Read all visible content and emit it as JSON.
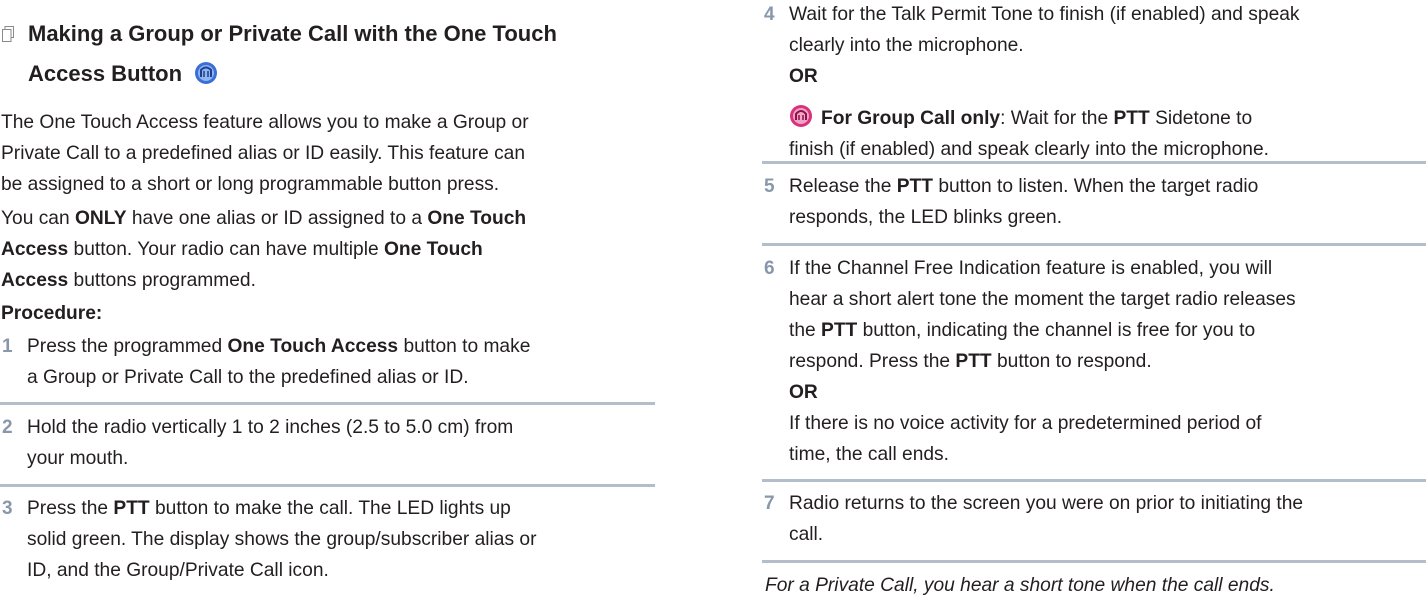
{
  "left": {
    "section_icon": "stacked-pages-icon",
    "title_line1": "Making a Group or Private Call with the One Touch",
    "title_line2": "Access Button",
    "title_button_icon": "one-touch-access-icon",
    "intro_line1": "The One Touch Access feature allows you to make a Group or",
    "intro_line2": "Private Call to a predefined alias or ID easily. This feature can",
    "intro_line3": "be assigned to a short or long programmable button press.",
    "p2_l1_a": "You can ",
    "p2_l1_b": "ONLY",
    "p2_l1_c": " have one alias or ID assigned to a ",
    "p2_l1_d": "One Touch",
    "p2_l2_a": "Access",
    "p2_l2_b": " button. Your radio can have multiple ",
    "p2_l2_c": "One Touch",
    "p2_l3_a": "Access",
    "p2_l3_b": " buttons programmed.",
    "procedure": "Procedure:",
    "s1_num": "1",
    "s1_l1_a": "Press the programmed ",
    "s1_l1_b": "One Touch Access",
    "s1_l1_c": " button to make",
    "s1_l2": "a Group or Private Call to the predefined alias or ID.",
    "s2_num": "2",
    "s2_l1": "Hold the radio vertically 1 to 2 inches (2.5 to 5.0 cm) from",
    "s2_l2": "your mouth.",
    "s3_num": "3",
    "s3_l1_a": "Press the ",
    "s3_l1_b": "PTT",
    "s3_l1_c": " button to make the call. The LED lights up",
    "s3_l2": "solid green. The display shows the group/subscriber alias or",
    "s3_l3": "ID, and the Group/Private Call icon."
  },
  "right": {
    "s4_num": "4",
    "s4_l1": "Wait for the Talk Permit Tone to finish (if enabled) and speak",
    "s4_l2": "clearly into the microphone.",
    "s4_or": "OR",
    "s4_icon": "ptt-sidetone-icon",
    "s4_l3_a": "For Group Call only",
    "s4_l3_b": ": Wait for the ",
    "s4_l3_c": "PTT",
    "s4_l3_d": " Sidetone to",
    "s4_l4": "finish (if enabled) and speak clearly into the microphone.",
    "s5_num": "5",
    "s5_l1_a": "Release the ",
    "s5_l1_b": "PTT",
    "s5_l1_c": " button to listen. When the target radio",
    "s5_l2": "responds, the LED blinks green.",
    "s6_num": "6",
    "s6_l1": "If the Channel Free Indication feature is enabled, you will",
    "s6_l2": "hear a short alert tone the moment the target radio releases",
    "s6_l3_a": "the ",
    "s6_l3_b": "PTT",
    "s6_l3_c": " button, indicating the channel is free for you to",
    "s6_l4_a": "respond. Press the ",
    "s6_l4_b": "PTT",
    "s6_l4_c": " button to respond.",
    "s6_or": "OR",
    "s6_l5": "If there is no voice activity for a predetermined period of",
    "s6_l6": "time, the call ends.",
    "s7_num": "7",
    "s7_l1": "Radio returns to the screen you were on prior to initiating the",
    "s7_l2": "call.",
    "note": "For a Private Call, you hear a short tone when the call ends."
  },
  "colors": {
    "step_number": "#8898aa",
    "rule": "#b4becb",
    "text": "#231f20",
    "icon_blue": "#3a6fd8",
    "icon_pink": "#d8327a"
  }
}
